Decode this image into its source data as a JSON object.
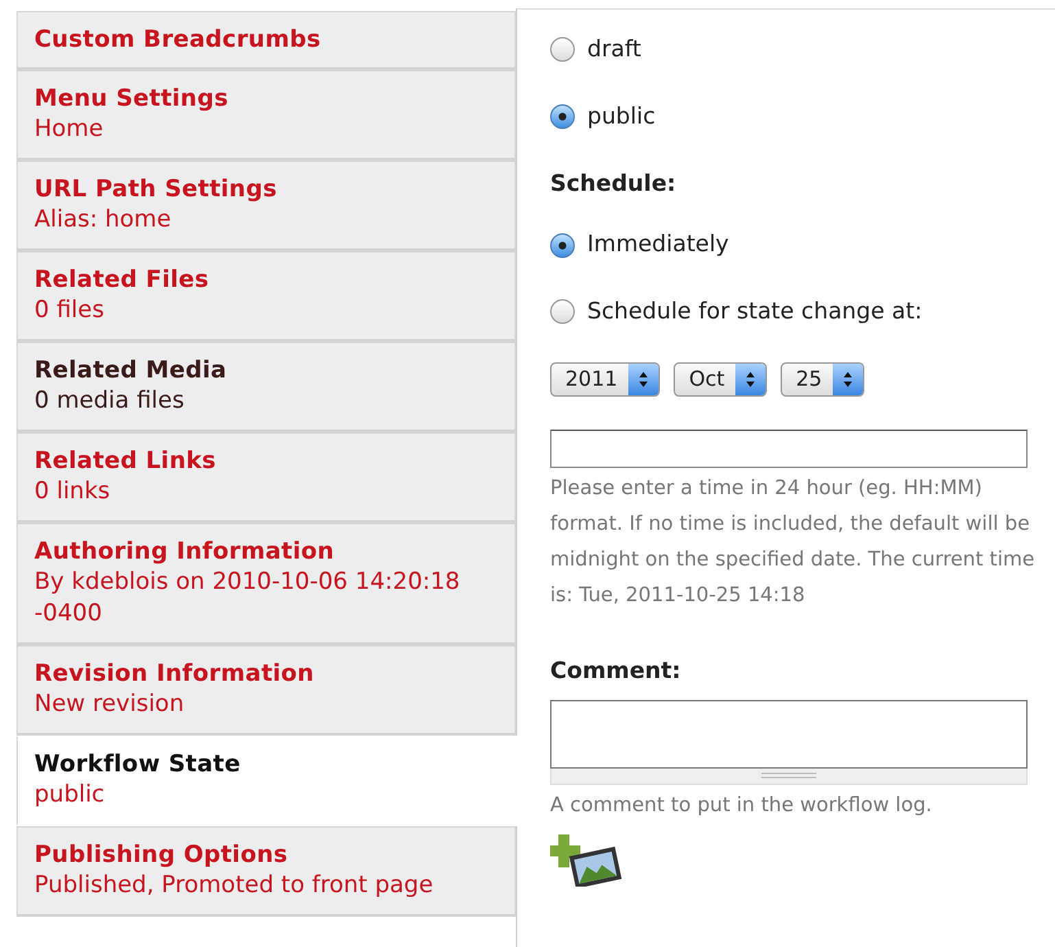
{
  "tabs": [
    {
      "title": "Custom Breadcrumbs",
      "selected": false,
      "hovered": false
    },
    {
      "title": "Menu Settings",
      "summary": "Home",
      "selected": false,
      "hovered": false
    },
    {
      "title": "URL Path Settings",
      "summary": "Alias: home",
      "selected": false,
      "hovered": false
    },
    {
      "title": "Related Files",
      "summary": "0 files",
      "selected": false,
      "hovered": false
    },
    {
      "title": "Related Media",
      "summary": "0 media files",
      "selected": false,
      "hovered": true
    },
    {
      "title": "Related Links",
      "summary": "0 links",
      "selected": false,
      "hovered": false
    },
    {
      "title": "Authoring Information",
      "summary": "By kdeblois on 2010-10-06 14:20:18 -0400",
      "selected": false,
      "hovered": false
    },
    {
      "title": "Revision Information",
      "summary": "New revision",
      "selected": false,
      "hovered": false
    },
    {
      "title": "Workflow State",
      "summary": "public",
      "selected": true,
      "hovered": false
    },
    {
      "title": "Publishing Options",
      "summary": "Published, Promoted to front page",
      "selected": false,
      "hovered": false
    }
  ],
  "state_options": [
    {
      "label": "draft",
      "selected": false
    },
    {
      "label": "public",
      "selected": true
    }
  ],
  "schedule": {
    "label": "Schedule:",
    "options": [
      {
        "label": "Immediately",
        "selected": true
      },
      {
        "label": "Schedule for state change at:",
        "selected": false
      }
    ],
    "date_selects": [
      "2011",
      "Oct",
      "25"
    ],
    "time_help": "Please enter a time in 24 hour (eg. HH:MM) format. If no time is included, the default will be midnight on the specified date. The current time is: Tue, 2011-10-25 14:18"
  },
  "comment": {
    "label": "Comment:",
    "help": "A comment to put in the workflow log."
  }
}
